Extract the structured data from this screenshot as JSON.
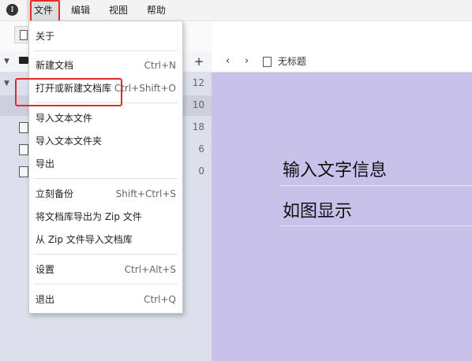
{
  "menubar": {
    "items": [
      {
        "label": "文件"
      },
      {
        "label": "编辑"
      },
      {
        "label": "视图"
      },
      {
        "label": "帮助"
      }
    ]
  },
  "sidebar": {
    "counts": [
      "12",
      "10",
      "18",
      "6",
      "0"
    ]
  },
  "editor": {
    "tab_title": "无标题",
    "lines": [
      "输入文字信息",
      "如图显示"
    ]
  },
  "file_menu": {
    "about": {
      "label": "关于"
    },
    "new_doc": {
      "label": "新建文档",
      "shortcut": "Ctrl+N"
    },
    "open_lib": {
      "label": "打开或新建文档库",
      "shortcut": "Ctrl+Shift+O"
    },
    "import_file": {
      "label": "导入文本文件"
    },
    "import_folder": {
      "label": "导入文本文件夹"
    },
    "export": {
      "label": "导出"
    },
    "backup": {
      "label": "立刻备份",
      "shortcut": "Shift+Ctrl+S"
    },
    "export_zip": {
      "label": "将文档库导出为 Zip 文件"
    },
    "import_zip": {
      "label": "从 Zip 文件导入文档库"
    },
    "settings": {
      "label": "设置",
      "shortcut": "Ctrl+Alt+S"
    },
    "quit": {
      "label": "退出",
      "shortcut": "Ctrl+Q"
    }
  },
  "colors": {
    "highlight": "#e02b2b",
    "editor_background": "#c8c1ea",
    "sidebar_background": "#dde0ec"
  },
  "icons": [
    "app-logo-icon",
    "document-icon",
    "database-icon",
    "plus-icon",
    "chevron-left-icon",
    "chevron-right-icon",
    "chevron-down-icon"
  ]
}
